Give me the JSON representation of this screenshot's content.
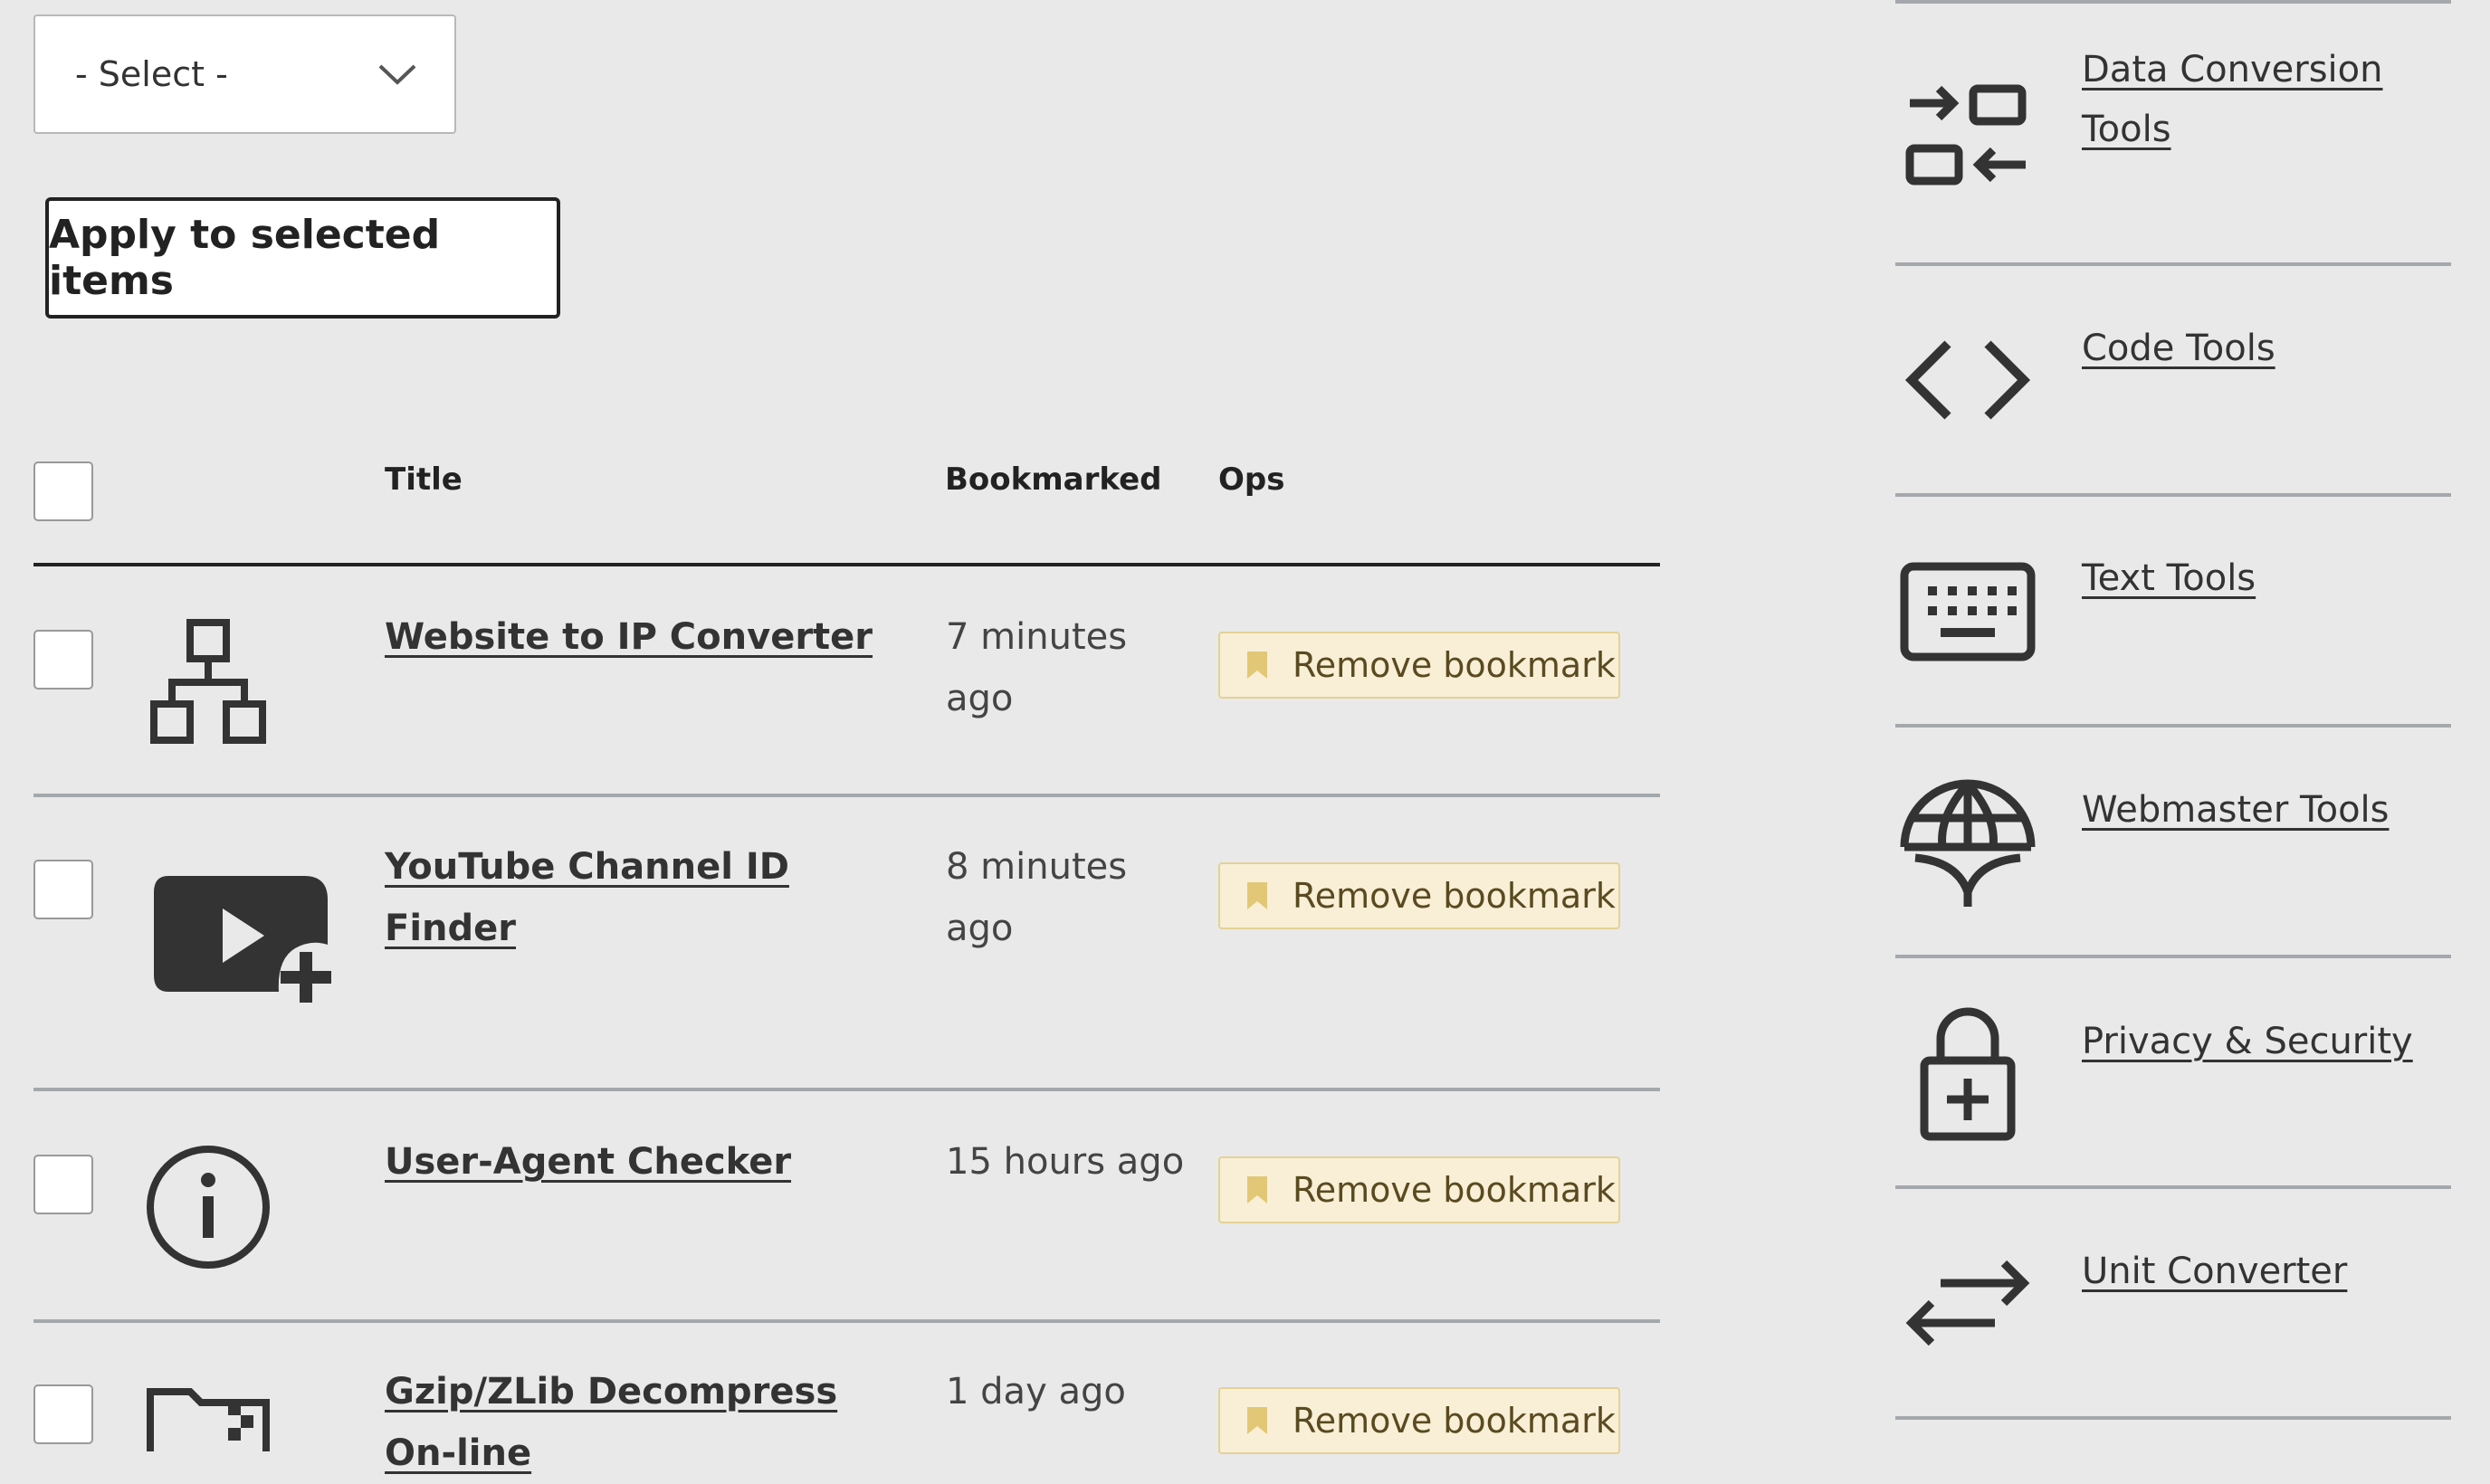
{
  "bulk": {
    "select_value": "- Select -",
    "apply_label": "Apply to selected items"
  },
  "table": {
    "headers": {
      "title": "Title",
      "bookmarked": "Bookmarked",
      "ops": "Ops"
    },
    "rows": [
      {
        "title": "Website to IP Converter",
        "bookmarked": "7 minutes ago",
        "op": "Remove bookmark",
        "icon": "sitemap-icon"
      },
      {
        "title": "YouTube Channel ID Finder",
        "bookmarked": "8 minutes ago",
        "op": "Remove bookmark",
        "icon": "video-add-icon"
      },
      {
        "title": "User-Agent Checker",
        "bookmarked": "15 hours ago",
        "op": "Remove bookmark",
        "icon": "info-icon"
      },
      {
        "title": "Gzip/ZLib Decompress On-line",
        "bookmarked": "1 day ago",
        "op": "Remove bookmark",
        "icon": "zip-folder-icon"
      }
    ]
  },
  "sidebar": {
    "items": [
      {
        "label": "Data Conversion Tools",
        "icon": "data-conversion-icon"
      },
      {
        "label": "Code Tools",
        "icon": "code-icon"
      },
      {
        "label": "Text Tools",
        "icon": "keyboard-icon"
      },
      {
        "label": "Webmaster Tools",
        "icon": "globe-icon"
      },
      {
        "label": "Privacy & Security",
        "icon": "lock-plus-icon"
      },
      {
        "label": "Unit Converter",
        "icon": "arrows-swap-icon"
      }
    ]
  },
  "colors": {
    "background": "#e9e9e9",
    "bookmark_button_bg": "#f8efd6",
    "bookmark_icon": "#e2c777",
    "rule": "#a4a8ad"
  }
}
